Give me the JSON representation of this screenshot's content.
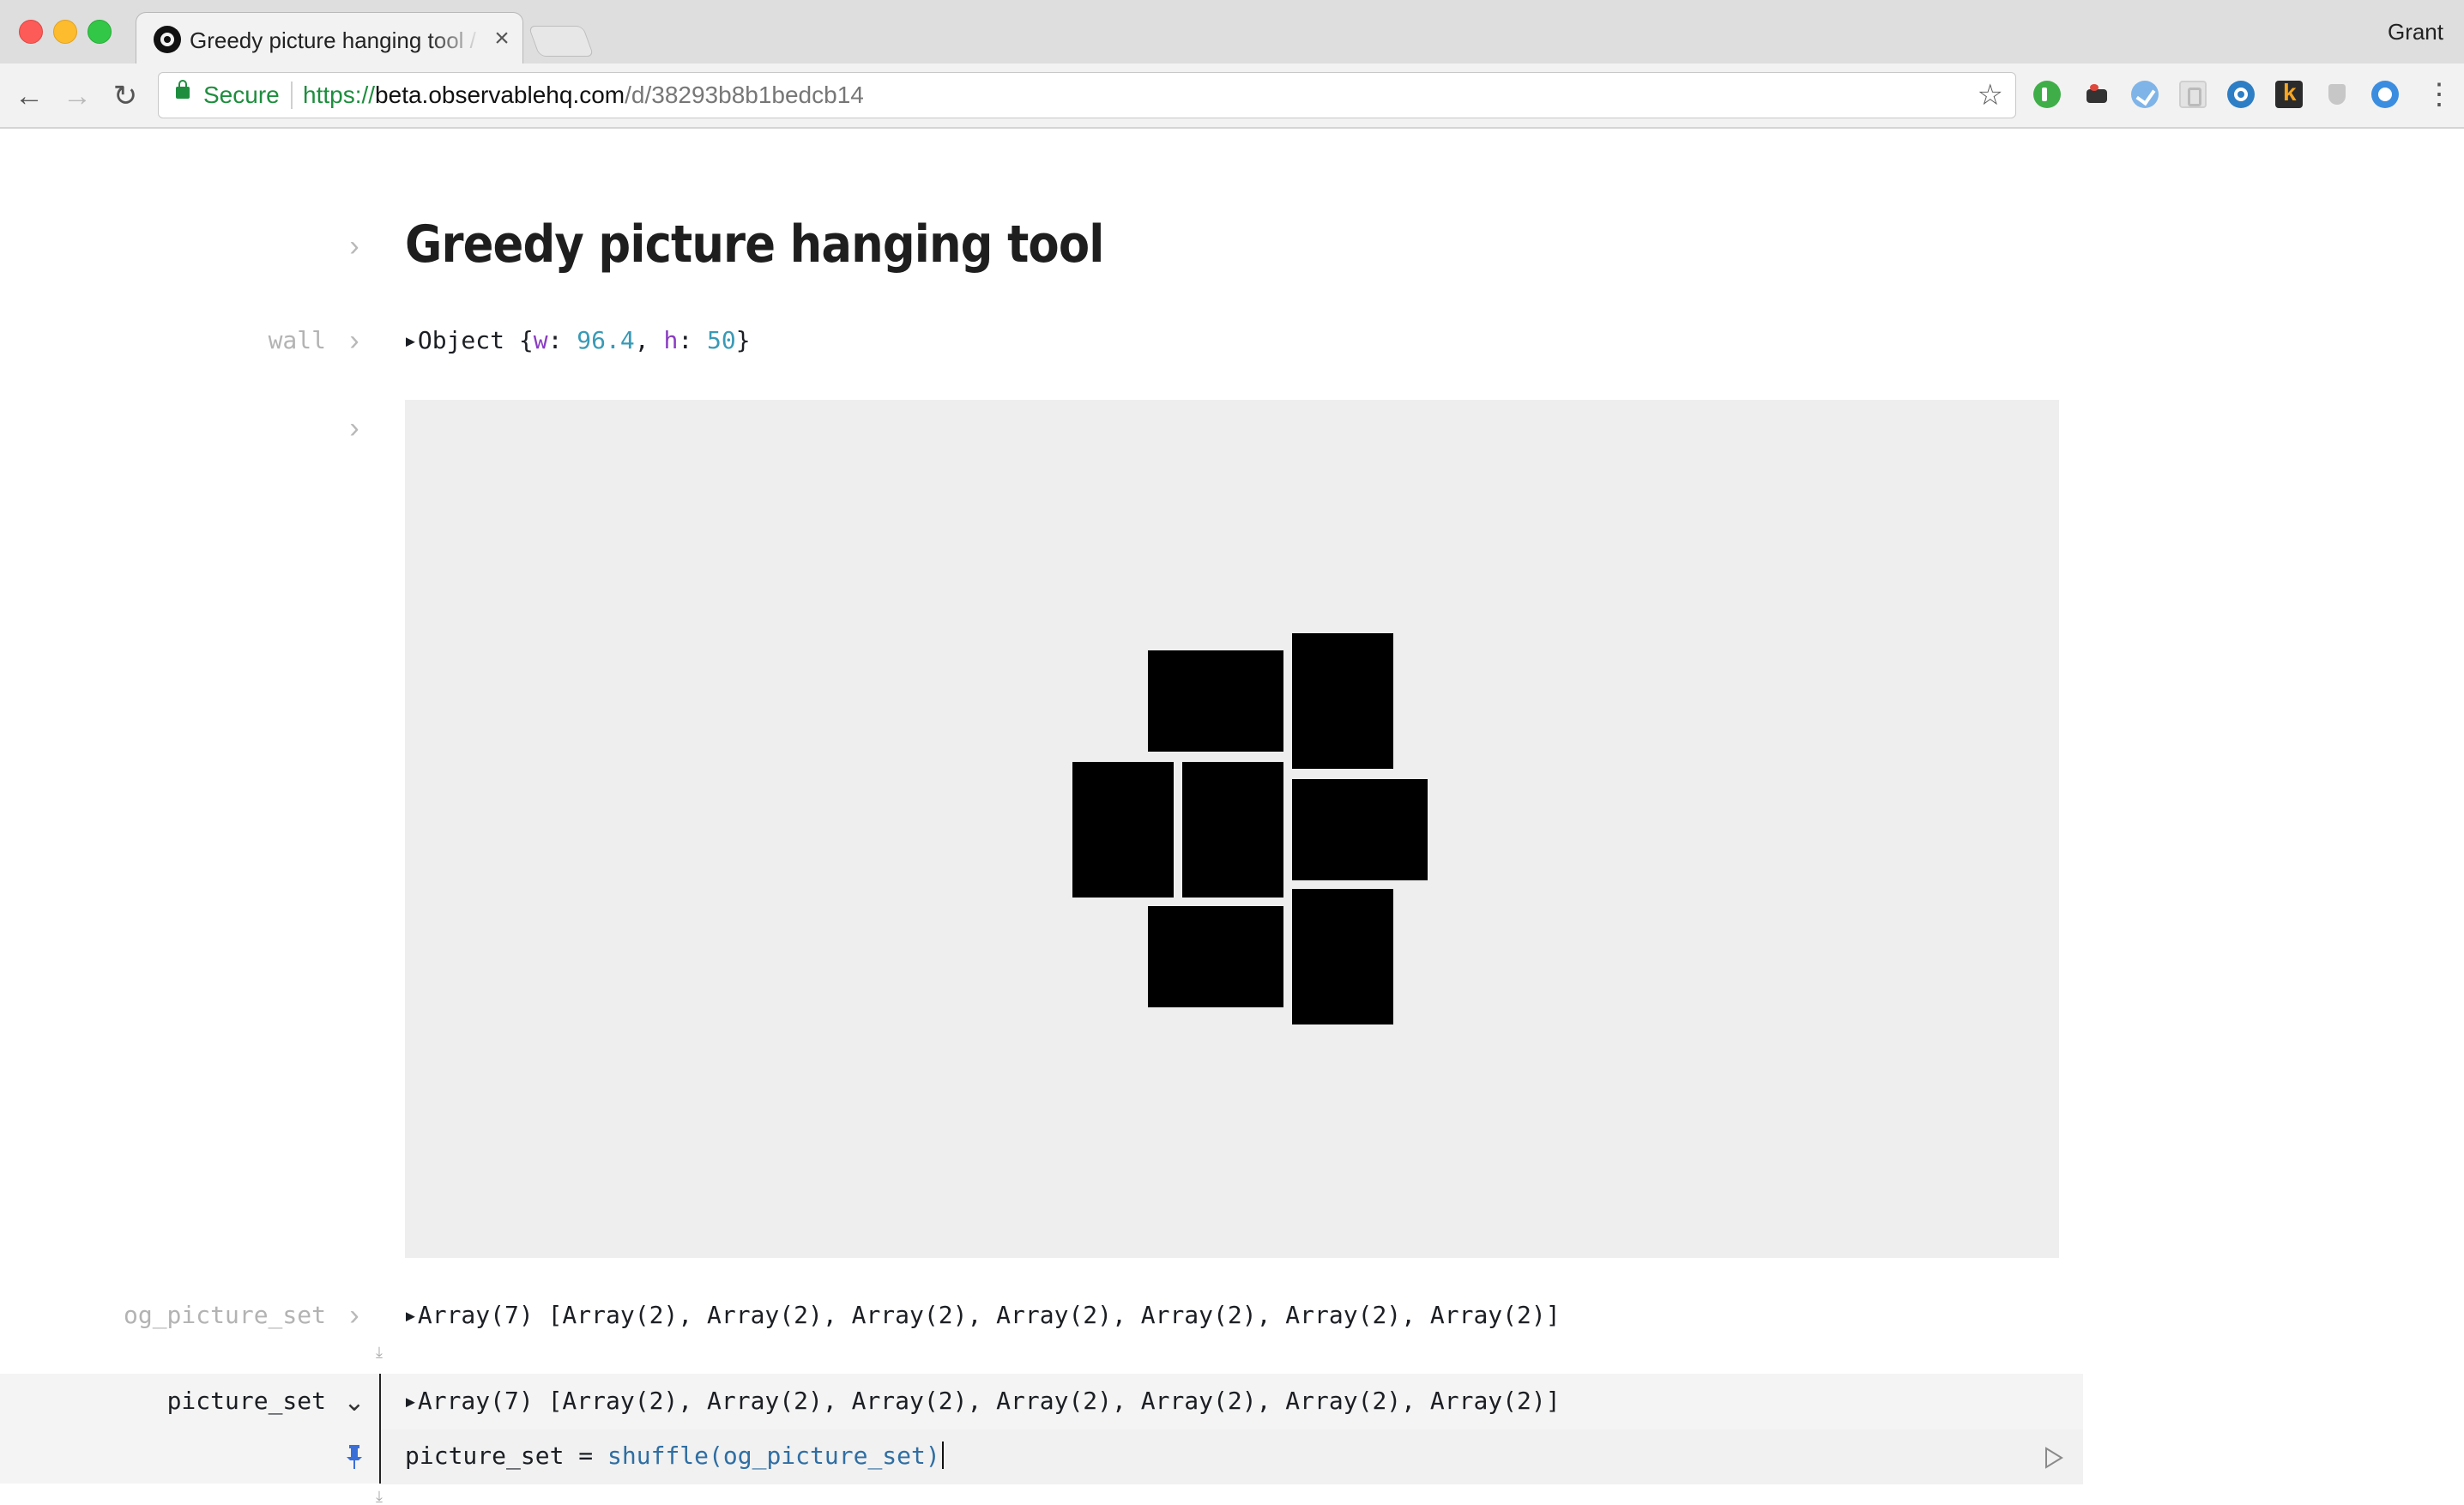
{
  "browser": {
    "tab_title": "Greedy picture hanging tool / Observable",
    "tab_close": "×",
    "profile": "Grant",
    "secure_label": "Secure",
    "url_scheme": "https://",
    "url_host": "beta.observablehq.com",
    "url_path": "/d/38293b8b1bedcb14",
    "nav": {
      "back": "←",
      "forward": "→",
      "reload": "↻"
    },
    "star": "☆",
    "menu": "⋮",
    "extensions": [
      "extension-icon-1",
      "extension-icon-2",
      "extension-icon-3",
      "extension-icon-4",
      "extension-icon-5",
      "extension-icon-6",
      "extension-icon-7",
      "extension-icon-8"
    ]
  },
  "notebook": {
    "title": "Greedy picture hanging tool",
    "chevron_closed": "›",
    "chevron_open": "⌄",
    "cells": {
      "wall": {
        "label": "wall",
        "prefix": "▸Object {",
        "w_key": "w",
        "w_val": "96.4",
        "h_key": "h",
        "h_val": "50",
        "colon": ": ",
        "comma": ", ",
        "suffix": "}"
      },
      "og_picture_set": {
        "label": "og_picture_set",
        "value": "▸Array(7) [Array(2), Array(2), Array(2), Array(2), Array(2), Array(2), Array(2)]"
      },
      "picture_set": {
        "label": "picture_set",
        "value": "▸Array(7) [Array(2), Array(2), Array(2), Array(2), Array(2), Array(2), Array(2)]",
        "code_lhs": "picture_set = ",
        "code_fn": "shuffle(og_picture_set)"
      }
    },
    "colors": {
      "wall": "#eeeeee",
      "picture": "#000000",
      "key": "#8a3cc3",
      "number": "#3a9ab6"
    }
  }
}
